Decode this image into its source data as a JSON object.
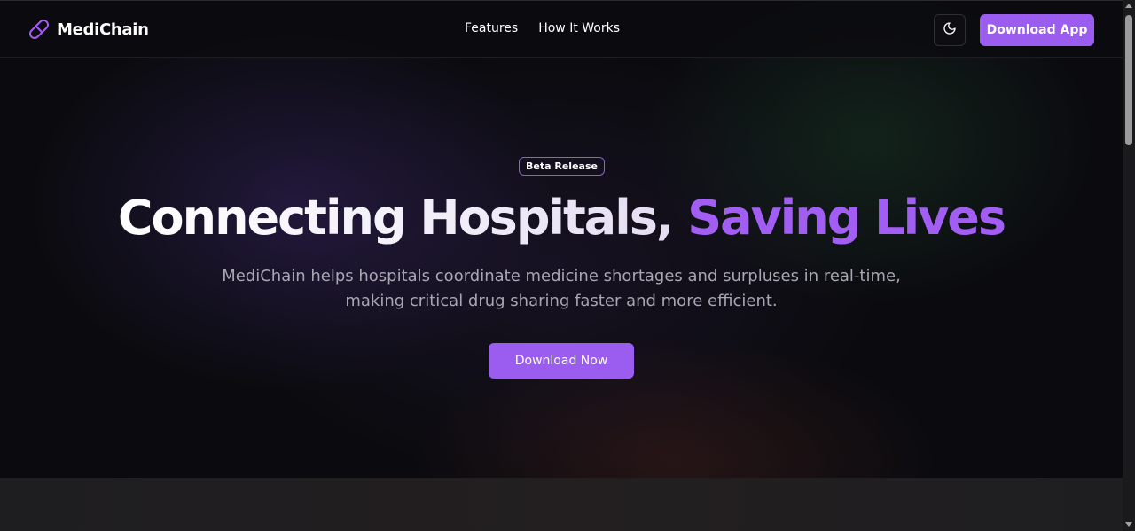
{
  "nav": {
    "brand": "MediChain",
    "brand_icon": "pill-icon",
    "links": [
      "Features",
      "How It Works"
    ],
    "theme_icon": "moon-icon",
    "cta": "Download App"
  },
  "hero": {
    "badge": "Beta Release",
    "headline_part1": "Connecting Hospitals,",
    "headline_part2": "Saving Lives",
    "subtitle": "MediChain helps hospitals coordinate medicine shortages and surpluses in real-time, making critical drug sharing faster and more efficient.",
    "cta": "Download Now"
  },
  "colors": {
    "accent": "#9b5cf0",
    "headline_accent": "#a25ef2",
    "background": "#0b0b0f",
    "muted_text": "#a9a6b3"
  }
}
